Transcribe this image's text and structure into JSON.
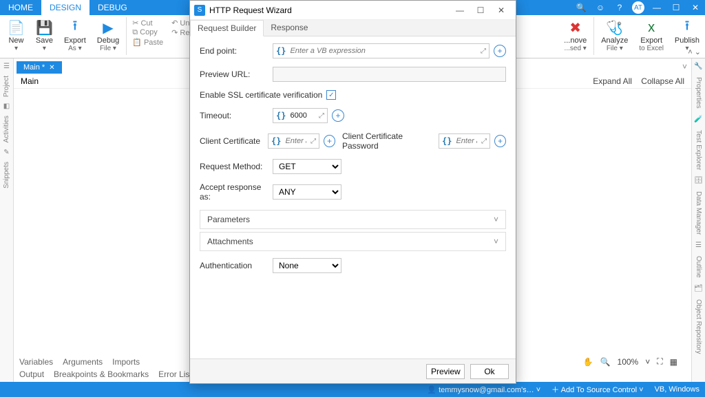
{
  "menu": {
    "home": "HOME",
    "design": "DESIGN",
    "debug": "DEBUG"
  },
  "title_ctl": {
    "avatar": "AT"
  },
  "ribbon": {
    "new": "New",
    "save": "Save",
    "exportas": "Export",
    "exportas2": "As ▾",
    "debugfile": "Debug",
    "debugfile2": "File ▾",
    "cut": "Cut",
    "undo": "Undo",
    "copy": "Copy",
    "redo": "Redo",
    "paste": "Paste",
    "remove": "...nove",
    "unused": "...sed ▾",
    "analyze": "Analyze",
    "analyze2": "File ▾",
    "excel": "Export",
    "excel2": "to Excel",
    "publish": "Publish",
    "publish2": "▾"
  },
  "sideleft": {
    "project": "Project",
    "activities": "Activities",
    "snippets": "Snippets"
  },
  "sideright": {
    "properties": "Properties",
    "test": "Test Explorer",
    "data": "Data Manager",
    "outline": "Outline",
    "repo": "Object Repository"
  },
  "doctab": {
    "name": "Main *"
  },
  "docheader": {
    "title": "Main",
    "expand": "Expand All",
    "collapse": "Collapse All"
  },
  "bottom": {
    "vars": "Variables",
    "args": "Arguments",
    "imports": "Imports"
  },
  "bottom2": {
    "output": "Output",
    "bp": "Breakpoints & Bookmarks",
    "err": "Error List"
  },
  "zoom": {
    "pct": "100%"
  },
  "status": {
    "email": "temmysnow@gmail.com's…",
    "add": "Add To Source Control",
    "lang": "VB, Windows"
  },
  "dialog": {
    "title": "HTTP Request Wizard",
    "tabs": {
      "req": "Request Builder",
      "resp": "Response"
    },
    "endpoint_label": "End point:",
    "endpoint_ph": "Enter a VB expression",
    "preview_label": "Preview URL:",
    "ssl_label": "Enable SSL certificate verification",
    "timeout_label": "Timeout:",
    "timeout_val": "6000",
    "cert_label": "Client Certificate",
    "cert_ph": "Enter a VB",
    "certpw_label": "Client Certificate Password",
    "certpw_ph": "Enter a VB",
    "method_label": "Request Method:",
    "method_val": "GET",
    "accept_label": "Accept response as:",
    "accept_val": "ANY",
    "params": "Parameters",
    "attach": "Attachments",
    "auth_label": "Authentication",
    "auth_val": "None",
    "preview_btn": "Preview",
    "ok_btn": "Ok"
  }
}
